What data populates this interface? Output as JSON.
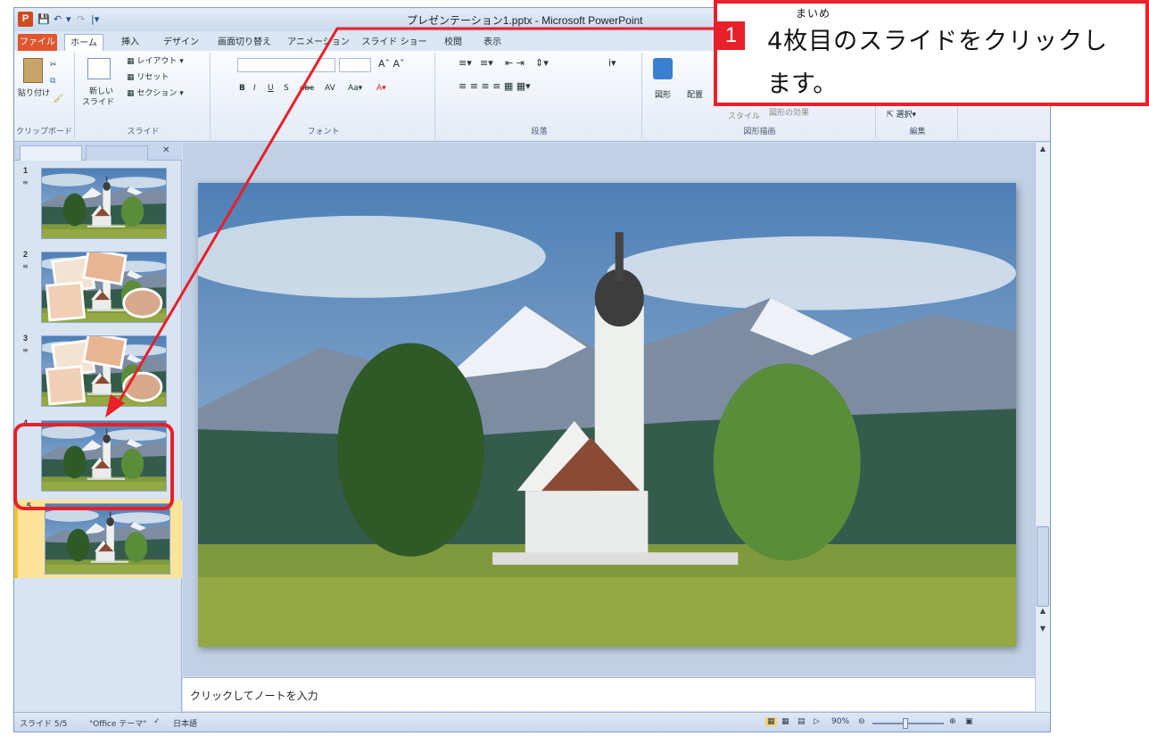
{
  "window": {
    "title": "プレゼンテーション1.pptx - Microsoft PowerPoint"
  },
  "tabs": [
    "ファイル",
    "ホーム",
    "挿入",
    "デザイン",
    "画面切り替え",
    "アニメーション",
    "スライド ショー",
    "校閲",
    "表示"
  ],
  "ribbon": {
    "clipboard": {
      "paste": "貼り付け",
      "label": "クリップボード"
    },
    "slides": {
      "new_slide_1": "新しい",
      "new_slide_2": "スライド",
      "layout": "レイアウト",
      "reset": "リセット",
      "section": "セクション",
      "label": "スライド"
    },
    "font": {
      "label": "フォント"
    },
    "paragraph": {
      "label": "段落"
    },
    "drawing": {
      "shapes": "図形",
      "arrange": "配置",
      "styles": "スタイル",
      "effects": "図形の効果",
      "label": "図形描画"
    },
    "editing": {
      "select": "選択",
      "label": "編集"
    }
  },
  "slides_panel": {
    "slides": [
      {
        "num": "1"
      },
      {
        "num": "2"
      },
      {
        "num": "3"
      },
      {
        "num": "4"
      },
      {
        "num": "5"
      }
    ],
    "selected_index": 5
  },
  "notes": {
    "placeholder": "クリックしてノートを入力"
  },
  "status": {
    "slide": "スライド 5/5",
    "theme": "\"Office テーマ\"",
    "lang": "日本語",
    "zoom": "90%"
  },
  "callout": {
    "number": "1",
    "ruby": "まいめ",
    "line1": "4枚目のスライドをクリックし",
    "line2": "ます。"
  },
  "colors": {
    "annotation": "#e8202a",
    "file_tab": "#e2562f",
    "selected_slide": "#fbe39a"
  }
}
